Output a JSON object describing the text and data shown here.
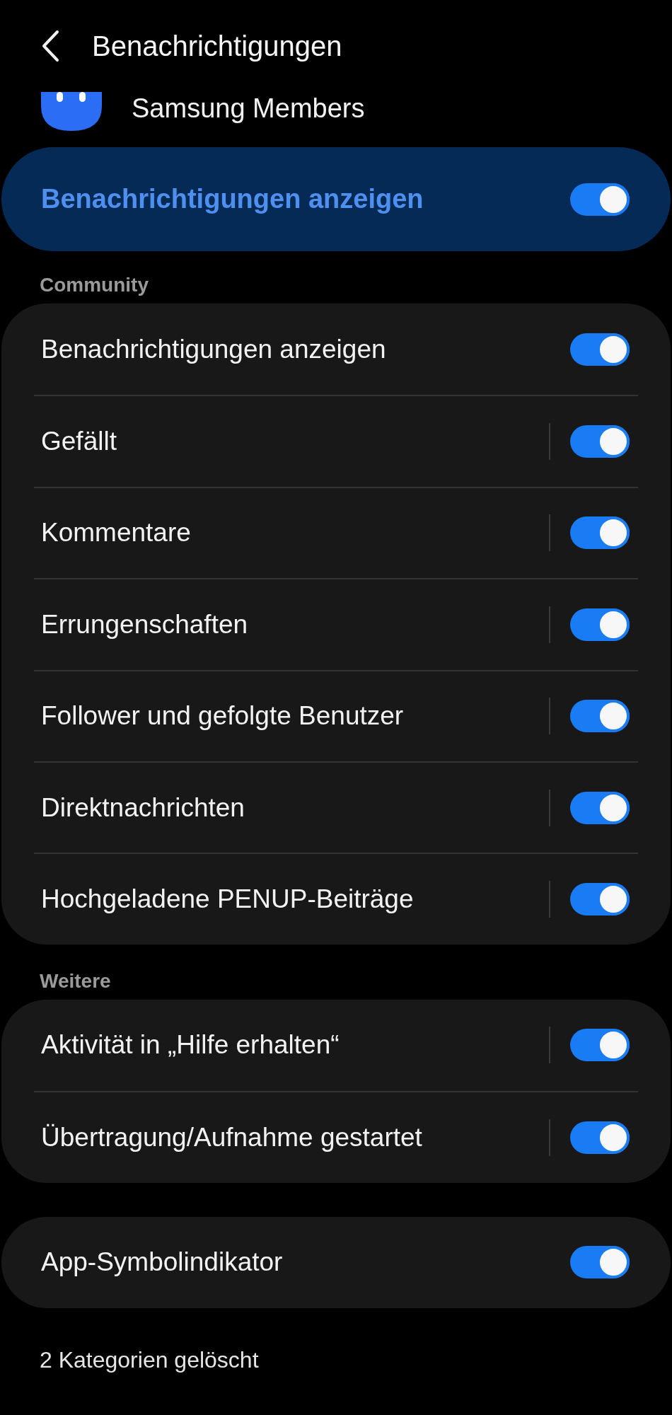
{
  "header": {
    "title": "Benachrichtigungen"
  },
  "app": {
    "name": "Samsung Members"
  },
  "master": {
    "label": "Benachrichtigungen anzeigen",
    "on": true
  },
  "sections": [
    {
      "title": "Community",
      "items": [
        {
          "label": "Benachrichtigungen anzeigen",
          "on": true,
          "divider": false
        },
        {
          "label": "Gefällt",
          "on": true,
          "divider": true
        },
        {
          "label": "Kommentare",
          "on": true,
          "divider": true
        },
        {
          "label": "Errungenschaften",
          "on": true,
          "divider": true
        },
        {
          "label": "Follower und gefolgte Benutzer",
          "on": true,
          "divider": true
        },
        {
          "label": "Direktnachrichten",
          "on": true,
          "divider": true
        },
        {
          "label": "Hochgeladene PENUP-Beiträge",
          "on": true,
          "divider": true
        }
      ]
    },
    {
      "title": "Weitere",
      "items": [
        {
          "label": "Aktivität in „Hilfe erhalten“",
          "on": true,
          "divider": true
        },
        {
          "label": "Übertragung/Aufnahme gestartet",
          "on": true,
          "divider": true
        }
      ]
    },
    {
      "items": [
        {
          "label": "App-Symbolindikator",
          "on": true,
          "divider": false
        }
      ]
    }
  ],
  "footer": "2 Kategorien gelöscht"
}
